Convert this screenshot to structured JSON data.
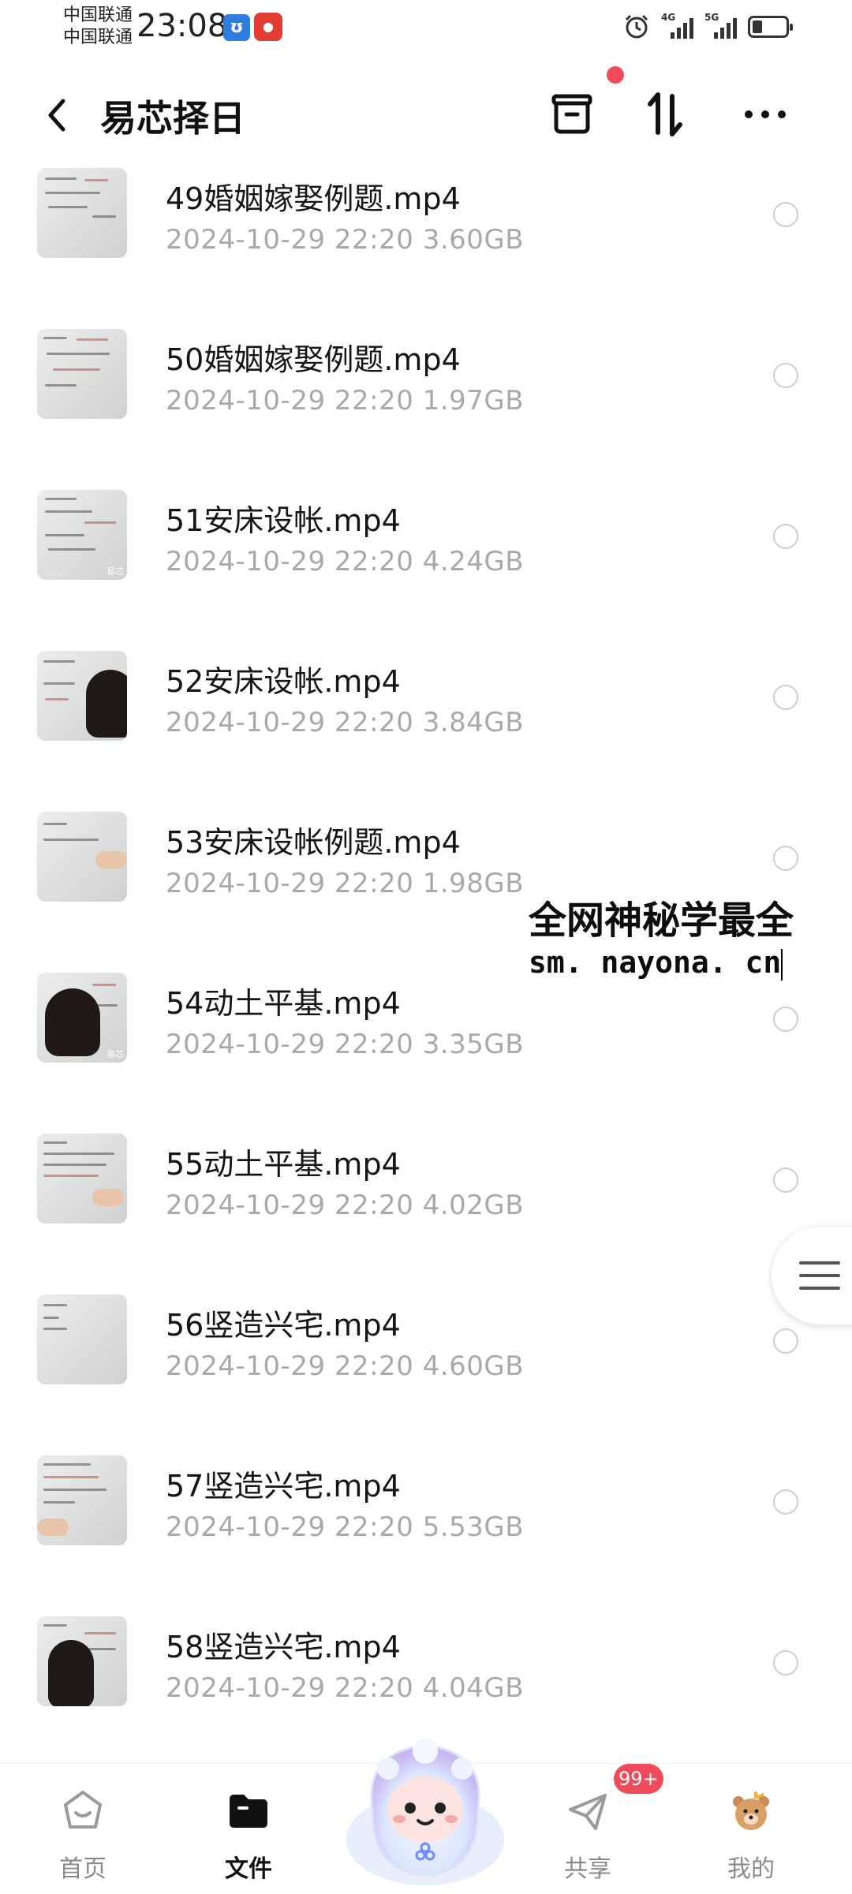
{
  "status_bar": {
    "carrier_1": "中国联通",
    "carrier_2": "中国联通",
    "time": "23:08",
    "net_1": "4G",
    "net_2": "5G"
  },
  "header": {
    "title": "易芯择日",
    "icons": [
      "back-arrow-icon",
      "box-icon",
      "sort-icon",
      "more-icon"
    ]
  },
  "files": [
    {
      "name": "49婚姻嫁娶例题.mp4",
      "date": "2024-10-29",
      "time": "22:20",
      "size": "3.60GB"
    },
    {
      "name": "50婚姻嫁娶例题.mp4",
      "date": "2024-10-29",
      "time": "22:20",
      "size": "1.97GB"
    },
    {
      "name": "51安床设帐.mp4",
      "date": "2024-10-29",
      "time": "22:20",
      "size": "4.24GB"
    },
    {
      "name": "52安床设帐.mp4",
      "date": "2024-10-29",
      "time": "22:20",
      "size": "3.84GB"
    },
    {
      "name": "53安床设帐例题.mp4",
      "date": "2024-10-29",
      "time": "22:20",
      "size": "1.98GB"
    },
    {
      "name": "54动土平基.mp4",
      "date": "2024-10-29",
      "time": "22:20",
      "size": "3.35GB"
    },
    {
      "name": "55动土平基.mp4",
      "date": "2024-10-29",
      "time": "22:20",
      "size": "4.02GB"
    },
    {
      "name": "56竖造兴宅.mp4",
      "date": "2024-10-29",
      "time": "22:20",
      "size": "4.60GB"
    },
    {
      "name": "57竖造兴宅.mp4",
      "date": "2024-10-29",
      "time": "22:20",
      "size": "5.53GB"
    },
    {
      "name": "58竖造兴宅.mp4",
      "date": "2024-10-29",
      "time": "22:20",
      "size": "4.04GB"
    }
  ],
  "overlay": {
    "line1": "全网神秘学最全",
    "line2": "sm. nayona. cn"
  },
  "tabbar": {
    "home": "首页",
    "files": "文件",
    "share": "共享",
    "mine": "我的",
    "share_badge": "99+"
  },
  "colors": {
    "accent_red": "#f04b5a",
    "meta_gray": "#a9a9a9"
  }
}
